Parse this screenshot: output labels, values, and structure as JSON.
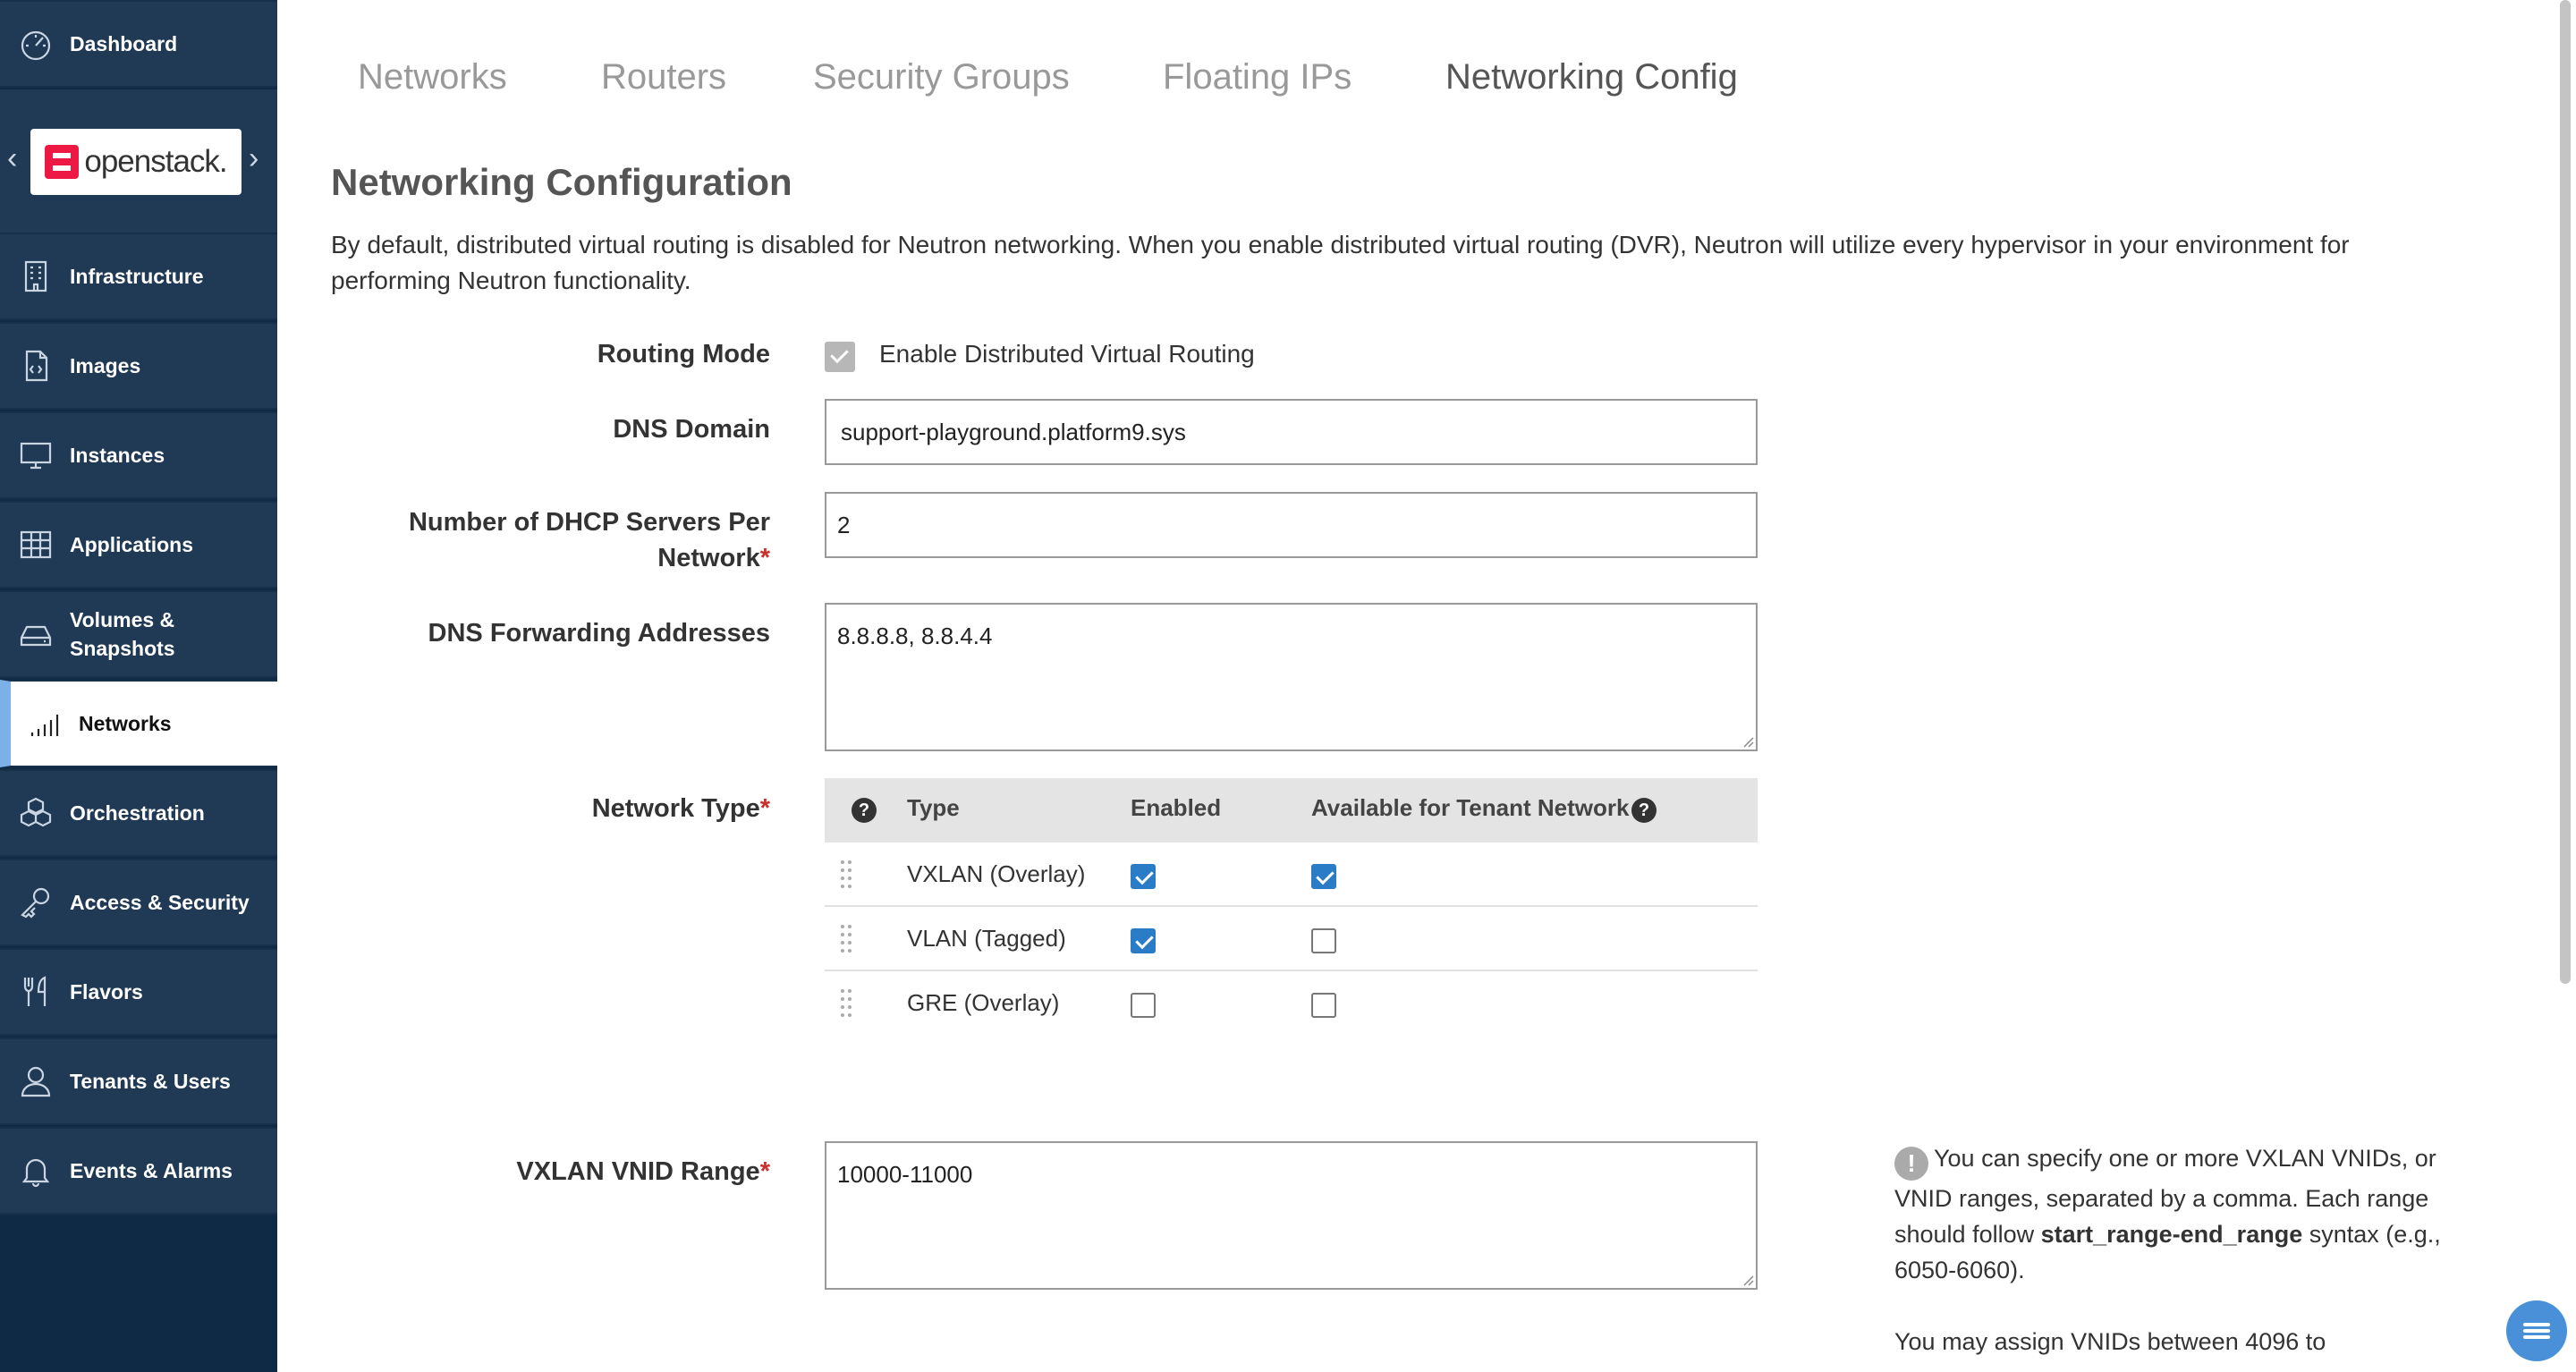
{
  "sidebar": {
    "dashboard": "Dashboard",
    "logo_text": "openstack.",
    "items": [
      {
        "label": "Infrastructure",
        "icon": "building-icon"
      },
      {
        "label": "Images",
        "icon": "file-code-icon"
      },
      {
        "label": "Instances",
        "icon": "monitor-icon"
      },
      {
        "label": "Applications",
        "icon": "grid-table-icon"
      },
      {
        "label": "Volumes & Snapshots",
        "icon": "hard-drive-icon"
      },
      {
        "label": "Networks",
        "icon": "signal-bars-icon"
      },
      {
        "label": "Orchestration",
        "icon": "cubes-icon"
      },
      {
        "label": "Access & Security",
        "icon": "key-icon"
      },
      {
        "label": "Flavors",
        "icon": "utensils-icon"
      },
      {
        "label": "Tenants & Users",
        "icon": "user-icon"
      },
      {
        "label": "Events & Alarms",
        "icon": "bell-icon"
      }
    ],
    "active": "Networks"
  },
  "tabs": [
    "Networks",
    "Routers",
    "Security Groups",
    "Floating IPs",
    "Networking Config"
  ],
  "active_tab": "Networking Config",
  "main": {
    "title": "Networking Configuration",
    "intro": "By default, distributed virtual routing is disabled for Neutron networking. When you enable distributed virtual routing (DVR), Neutron will utilize every hypervisor in your environment for performing Neutron functionality.",
    "routing_mode_label": "Routing Mode",
    "routing_mode_option": "Enable Distributed Virtual Routing",
    "dns_domain_label": "DNS Domain",
    "dns_domain_value": "support-playground.platform9.sys",
    "dhcp_label_line1": "Number of DHCP Servers Per",
    "dhcp_label_line2": "Network",
    "dhcp_value": "2",
    "dns_fwd_label": "DNS Forwarding Addresses",
    "dns_fwd_value": "8.8.8.8, 8.8.4.4",
    "network_type_label": "Network Type",
    "required_marker": "*",
    "network_types": {
      "headers": {
        "type": "Type",
        "enabled": "Enabled",
        "tenant": "Available for Tenant Network"
      },
      "help_glyph": "?",
      "rows": [
        {
          "type": "VXLAN (Overlay)",
          "enabled": true,
          "tenant": true
        },
        {
          "type": "VLAN (Tagged)",
          "enabled": true,
          "tenant": false
        },
        {
          "type": "GRE (Overlay)",
          "enabled": false,
          "tenant": false
        }
      ]
    },
    "vxlan_label": "VXLAN VNID Range",
    "vxlan_value": "10000-11000",
    "info": {
      "glyph": "!",
      "p1_before": "You can specify one or more VXLAN VNIDs, or VNID ranges, separated by a comma. Each range should follow ",
      "p1_bold": "start_range-end_range",
      "p1_after": " syntax (e.g., 6050-6060).",
      "p2": "You may assign VNIDs between 4096 to"
    }
  },
  "colors": {
    "sidebar_bg": "#0f2a44",
    "sidebar_item_bg": "#203a55",
    "active_accent": "#7cb1e8",
    "checkbox_checked": "#2a7cc7",
    "required": "#c9302c"
  }
}
